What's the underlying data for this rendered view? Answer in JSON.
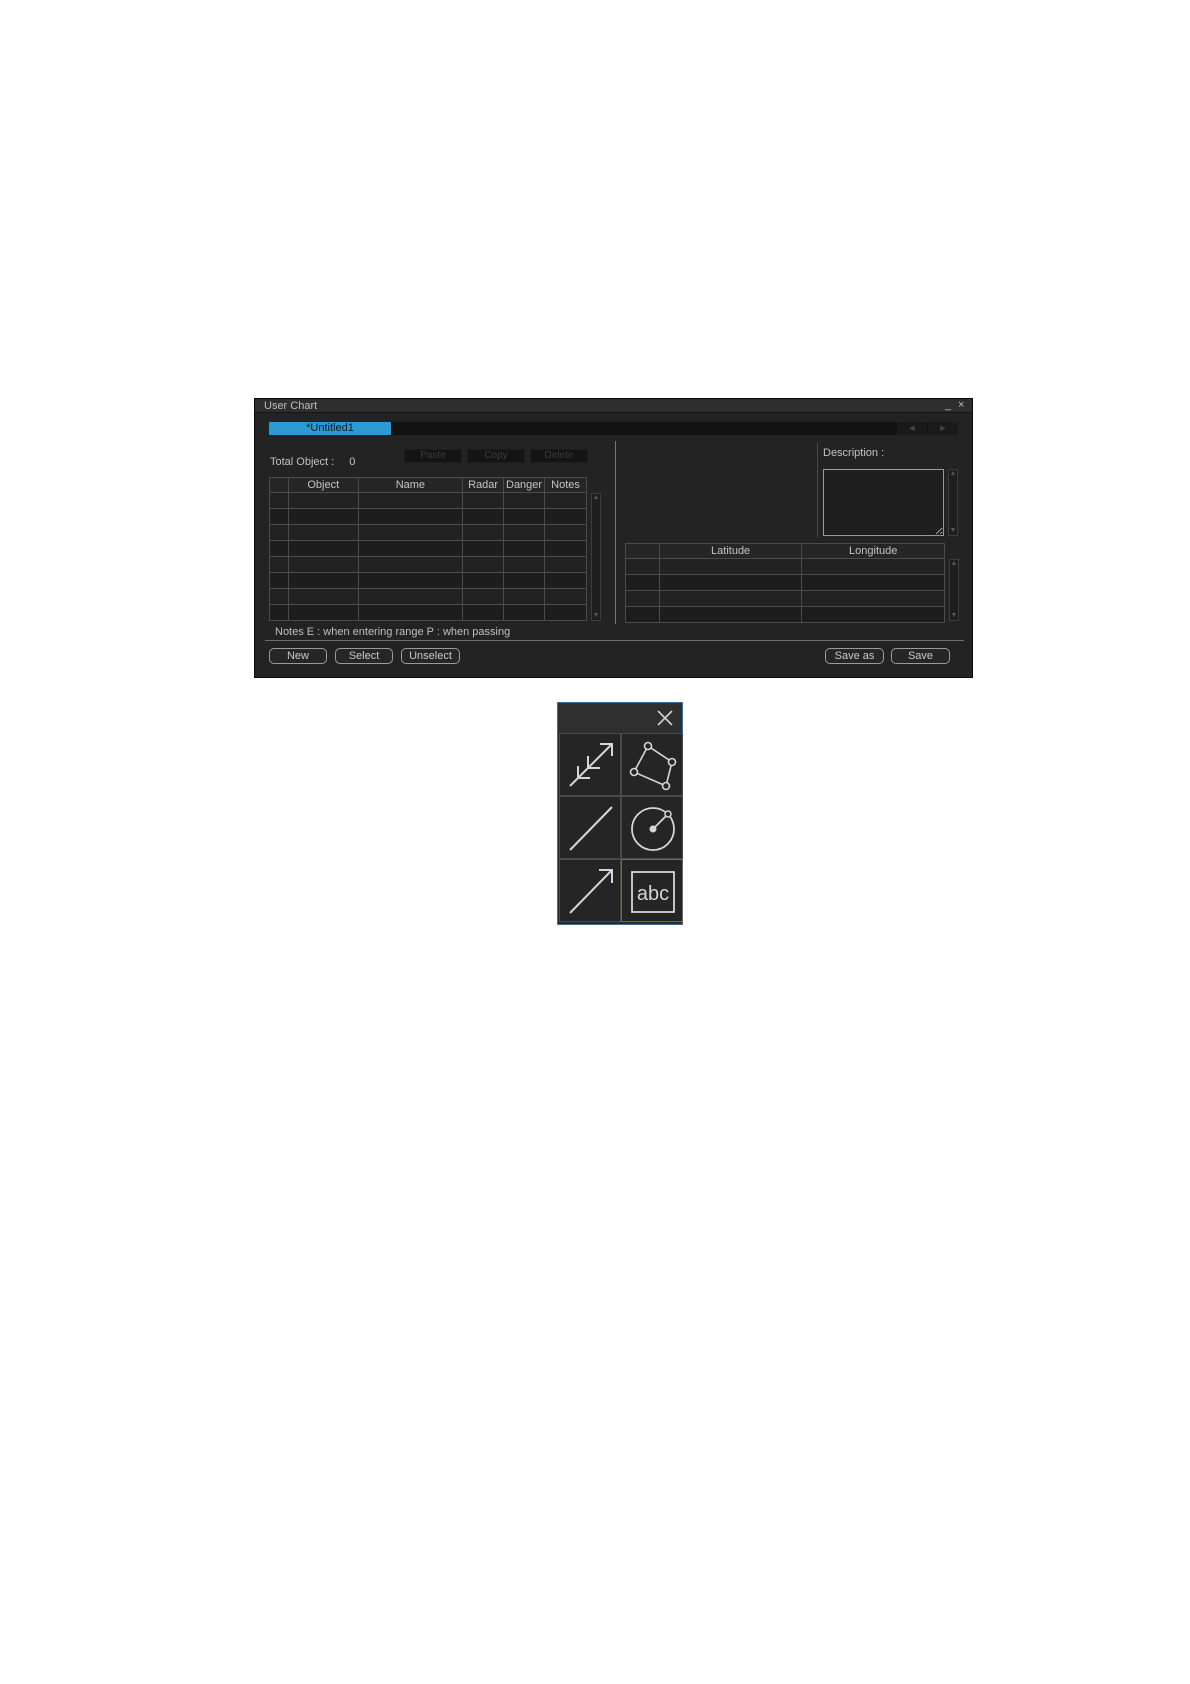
{
  "window": {
    "title": "User Chart",
    "minimize_glyph": "_",
    "close_glyph": "×",
    "tab_label": "*Untitled1",
    "tab_scroll_left": "◄",
    "tab_scroll_right": "►"
  },
  "objects_panel": {
    "total_label": "Total Object :",
    "total_value": "0",
    "paste_label": "Paste",
    "copy_label": "Copy",
    "delete_label": "Delete",
    "columns": [
      "",
      "Object",
      "Name",
      "Radar",
      "Danger",
      "Notes"
    ],
    "notes_legend": "Notes  E : when entering range  P : when passing"
  },
  "detail_panel": {
    "description_label": "Description :",
    "columns": [
      "",
      "Latitude",
      "Longitude"
    ]
  },
  "buttons": {
    "new": "New",
    "select": "Select",
    "unselect": "Unselect",
    "save_as": "Save as",
    "save": "Save"
  },
  "palette": {
    "tools": [
      {
        "name": "multi-arrow-tool-icon"
      },
      {
        "name": "polygon-tool-icon"
      },
      {
        "name": "line-tool-icon"
      },
      {
        "name": "circle-tool-icon"
      },
      {
        "name": "arrow-tool-icon"
      },
      {
        "name": "text-tool-icon",
        "label": "abc"
      }
    ]
  },
  "colors": {
    "window_bg": "#232323",
    "tab_active": "#2c9bd3",
    "palette_border": "#3d6e96",
    "text": "#c8c8c8"
  }
}
